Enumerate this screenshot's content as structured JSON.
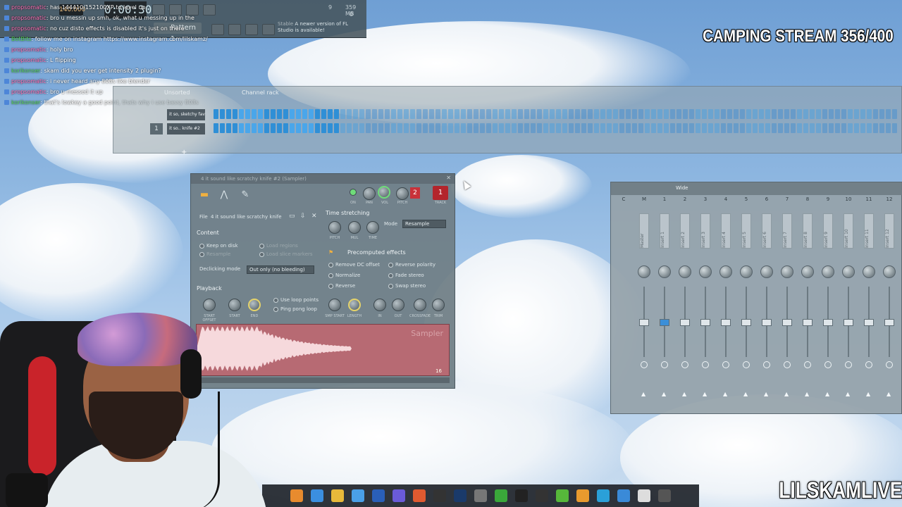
{
  "overlay": {
    "stream_title": "CAMPING STREAM 356/400",
    "brand": "LILSKAMLIVE"
  },
  "fl_topbar": {
    "bpm": "140.000",
    "clock": "0:00:30",
    "pattern": "Pattern 1",
    "cpu_a": "9",
    "cpu_b": "359 MB",
    "cpu_c": "0",
    "notice": "A newer version of FL Studio is available!",
    "notice_label": "Stable"
  },
  "chat": [
    {
      "user": "propsomatic",
      "text": "has 144410/152100XP to level up.",
      "green": false
    },
    {
      "user": "propsomatic",
      "text": "bro u messin up smh, ok, what u messing up in the",
      "green": false
    },
    {
      "user": "propsomatic",
      "text": "no cuz disto effects is disabled it's just on there",
      "green": false
    },
    {
      "user": "BotBits",
      "text": "follow me on instagram https://www.instagram.com/lilskamz/",
      "green": true
    },
    {
      "user": "propsomatic",
      "text": "holy bro",
      "green": false
    },
    {
      "user": "propsomatic",
      "text": "L flipping",
      "green": false
    },
    {
      "user": "korikonser",
      "text": "skam did you ever get intensity 2 plugin?",
      "green": true
    },
    {
      "user": "propsomatic",
      "text": "i never heard any 808s like blender",
      "green": false
    },
    {
      "user": "propsomatic",
      "text": "bro u messed it up",
      "green": false
    },
    {
      "user": "korikonser",
      "text": "that's lowkey a good point, thats why i use bassy 808s",
      "green": true
    }
  ],
  "channel_rack": {
    "filter": "Unsorted",
    "title": "Channel rack",
    "channels": [
      {
        "num": "",
        "name": "it so, sketchy fav"
      },
      {
        "num": "1",
        "name": "it so.. knife #2"
      }
    ]
  },
  "sampler": {
    "title": "4 it sound like scratchy knife #2 (Sampler)",
    "labels": {
      "on": "ON",
      "pan": "PAN",
      "vol": "VOL",
      "pitch": "PITCH",
      "track": "TRACK"
    },
    "track_a": "2",
    "track_b": "1",
    "file_label": "File",
    "file_name": "4 it sound like scratchy knife",
    "content": "Content",
    "keep_on_disk": "Keep on disk",
    "resample": "Resample",
    "load_regions": "Load regions",
    "load_slice_markers": "Load slice markers",
    "declicking_mode": "Declicking mode",
    "declicking_value": "Out only (no bleeding)",
    "playback": "Playback",
    "use_loop_points": "Use loop points",
    "ping_pong_loop": "Ping pong loop",
    "playback_knobs": [
      "START OFFSET",
      "START",
      "END"
    ],
    "time_stretching": "Time stretching",
    "mode_label": "Mode",
    "mode_value": "Resample",
    "stretch_knobs": [
      "PITCH",
      "MUL",
      "TIME"
    ],
    "precomputed": "Precomputed effects",
    "effects_left": [
      "Remove DC offset",
      "Normalize",
      "Reverse"
    ],
    "effects_right": [
      "Reverse polarity",
      "Fade stereo",
      "Swap stereo"
    ],
    "fx_knobs": [
      "SMP START",
      "LENGTH",
      "IN",
      "OUT",
      "CROSSFADE",
      "TRIM"
    ],
    "watermark": "Sampler",
    "zoom": "16"
  },
  "mixer": {
    "view": "Wide",
    "numbers": [
      "C",
      "M",
      "1",
      "2",
      "3",
      "4",
      "5",
      "6",
      "7",
      "8",
      "9",
      "10",
      "11",
      "12"
    ],
    "strips": [
      "Master",
      "Insert 1",
      "Insert 2",
      "Insert 3",
      "Insert 4",
      "Insert 5",
      "Insert 6",
      "Insert 7",
      "Insert 8",
      "Insert 9",
      "Insert 10",
      "Insert 11",
      "Insert 12"
    ]
  },
  "taskbar": [
    "fl-studio-icon",
    "chrome-icon",
    "folder-icon",
    "store-icon",
    "photoshop-icon",
    "discord-icon",
    "brave-icon",
    "obs-icon",
    "steam-icon",
    "settings-icon",
    "layers-icon",
    "headphones-icon",
    "capcut-icon",
    "utorrent-icon",
    "fl-icon",
    "notes-icon",
    "explorer-icon",
    "file-icon",
    "play-icon"
  ],
  "colors": {
    "accent_red": "#c8323a",
    "step_blue": "#3aa0e8",
    "wave": "#b76a73"
  }
}
